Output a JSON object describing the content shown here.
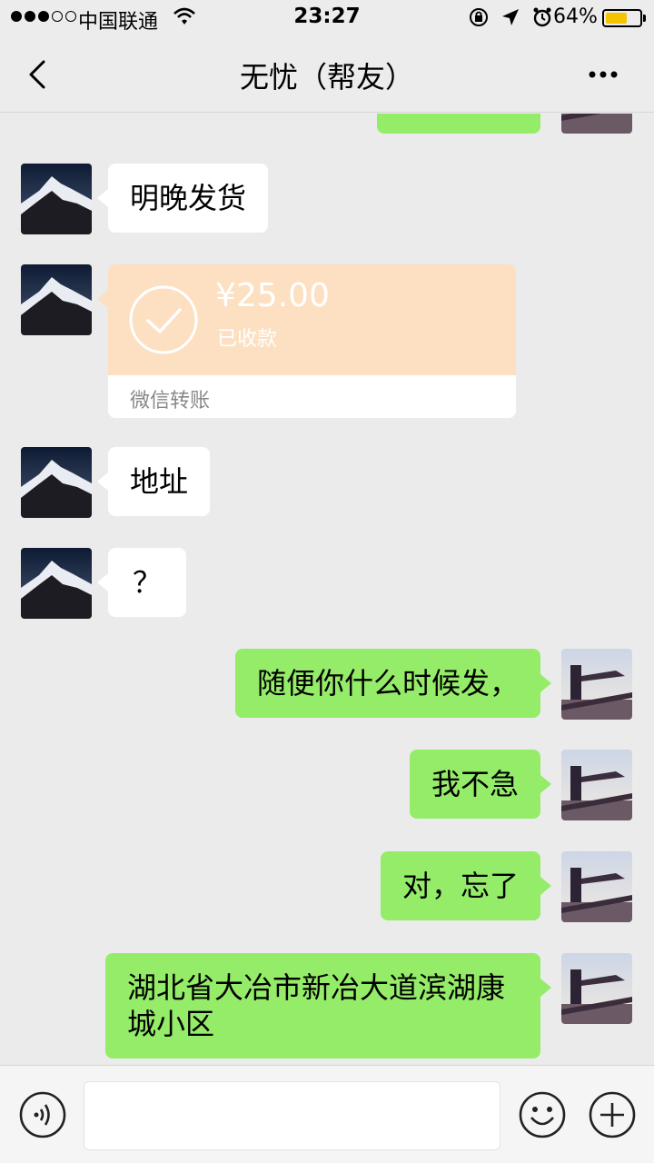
{
  "status_bar": {
    "carrier": "中国联通",
    "time": "23:27",
    "battery_percent": "64%",
    "battery_level": 0.64,
    "signal_bars_filled": 3,
    "signal_bars_total": 5
  },
  "nav": {
    "title": "无忧（帮友）",
    "back_icon": "chevron-left-icon",
    "more_icon": "more-dots-icon"
  },
  "messages": [
    {
      "side": "left",
      "type": "text",
      "text": "明晚发货"
    },
    {
      "side": "left",
      "type": "transfer",
      "amount": "¥25.00",
      "status": "已收款",
      "label": "微信转账"
    },
    {
      "side": "left",
      "type": "text",
      "text": "地址"
    },
    {
      "side": "left",
      "type": "text",
      "text": "？"
    },
    {
      "side": "right",
      "type": "text",
      "text": "随便你什么时候发，"
    },
    {
      "side": "right",
      "type": "text",
      "text": "我不急"
    },
    {
      "side": "right",
      "type": "text",
      "text": "对，忘了"
    },
    {
      "side": "right",
      "type": "text",
      "text": "湖北省大冶市新冶大道滨湖康城小区"
    }
  ],
  "colors": {
    "outgoing_bubble": "#95ec69",
    "incoming_bubble": "#ffffff",
    "transfer_bubble": "#fce0c1",
    "background": "#ebebeb",
    "battery": "#f5c400"
  },
  "input_bar": {
    "voice_icon": "voice-icon",
    "emoji_icon": "emoji-icon",
    "plus_icon": "plus-icon"
  }
}
